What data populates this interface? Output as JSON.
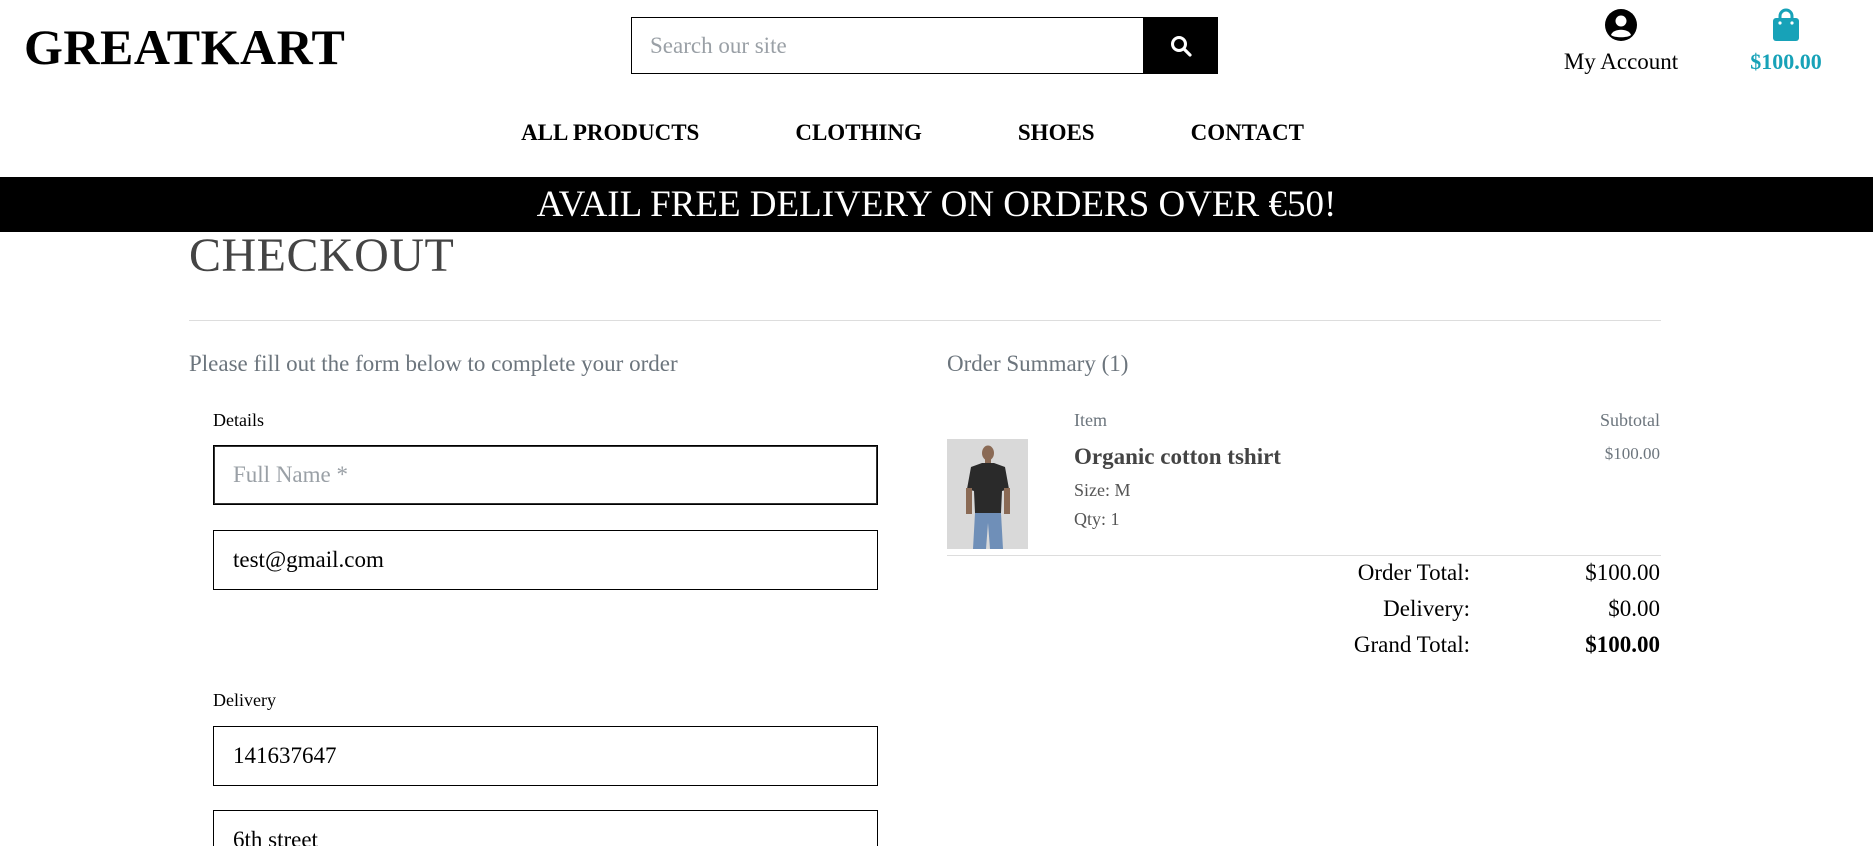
{
  "header": {
    "logo": "GREATKART",
    "search_placeholder": "Search our site",
    "account_label": "My Account",
    "bag_total": "$100.00"
  },
  "nav": {
    "items": [
      "ALL PRODUCTS",
      "CLOTHING",
      "SHOES",
      "CONTACT"
    ]
  },
  "banner": {
    "text": "AVAIL FREE DELIVERY ON ORDERS OVER €50!"
  },
  "checkout": {
    "title": "CHECKOUT",
    "intro": "Please fill out the form below to complete your order",
    "details_legend": "Details",
    "full_name_placeholder": "Full Name *",
    "email_value": "test@gmail.com",
    "delivery_legend": "Delivery",
    "phone_value": "141637647",
    "street_value": "6th street"
  },
  "summary": {
    "title": "Order Summary (1)",
    "col_item": "Item",
    "col_subtotal": "Subtotal",
    "product": {
      "name": "Organic cotton tshirt",
      "size": "Size: M",
      "qty": "Qty: 1",
      "price": "$100.00"
    },
    "order_total_label": "Order Total:",
    "order_total": "$100.00",
    "delivery_label": "Delivery:",
    "delivery": "$0.00",
    "grand_total_label": "Grand Total:",
    "grand_total": "$100.00"
  },
  "colors": {
    "accent": "#17a2b8",
    "banner_bg": "#000000",
    "muted_text": "#6c757d"
  },
  "icons": {
    "search": "search-icon",
    "account": "user-circle-icon",
    "bag": "shopping-bag-icon"
  }
}
